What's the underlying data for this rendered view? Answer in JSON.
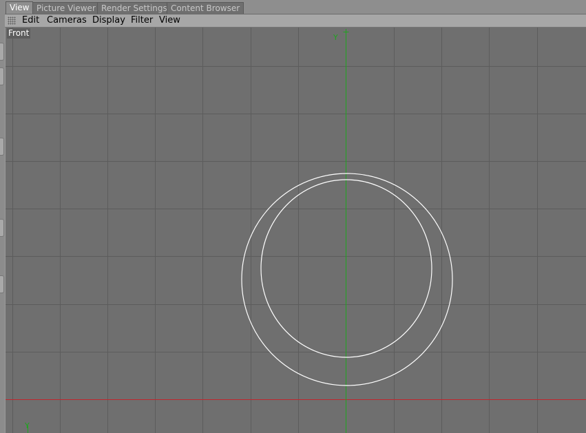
{
  "tabs": [
    {
      "label": "View",
      "active": true
    },
    {
      "label": "Picture Viewer",
      "active": false
    },
    {
      "label": "Render Settings",
      "active": false
    },
    {
      "label": "Content Browser",
      "active": false
    }
  ],
  "menu": {
    "items": [
      "Edit",
      "Cameras",
      "Display",
      "Filter",
      "View"
    ]
  },
  "viewport": {
    "label": "Front",
    "y_axis_label": "Y",
    "corner_axis_label": "Y",
    "colors": {
      "background": "#6f6f6f",
      "grid": "#5c5c5c",
      "y_axis": "#1fa51f",
      "x_axis": "#c0262d",
      "spline": "#ffffff"
    }
  }
}
